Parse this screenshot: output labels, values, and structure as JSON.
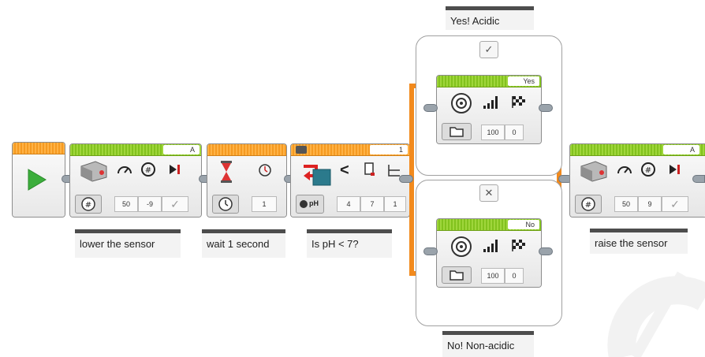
{
  "program": {
    "start_block": {
      "icon": "play-icon"
    },
    "motor1": {
      "port": "A",
      "power": "50",
      "degrees": "-9",
      "comment": "lower the sensor"
    },
    "wait": {
      "seconds": "1",
      "comment": "wait 1 second"
    },
    "compare": {
      "port": "1",
      "sensor_label": "pH",
      "mode_value": "4",
      "threshold": "7",
      "extra": "1",
      "comment": "Is pH < 7?"
    },
    "switch": {
      "yes_case": {
        "title": "Yes! Acidic",
        "header_label": "Yes",
        "volume": "100",
        "play_type": "0"
      },
      "no_case": {
        "title": "No! Non-acidic",
        "header_label": "No",
        "volume": "100",
        "play_type": "0"
      }
    },
    "motor2": {
      "port": "A",
      "power": "50",
      "degrees": "9",
      "comment": "raise the sensor"
    }
  },
  "colors": {
    "orange_wire": "#f28a1d",
    "green_header": "#82c21e",
    "orange_header": "#f59a21"
  }
}
